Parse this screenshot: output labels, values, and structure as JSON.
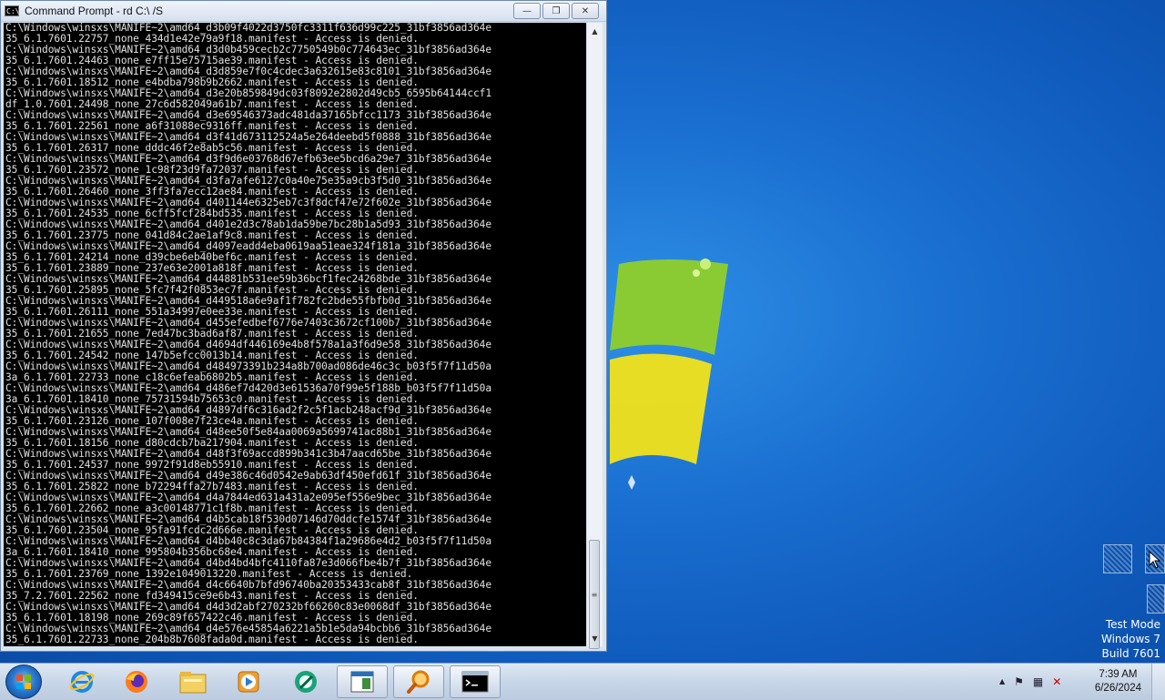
{
  "window": {
    "title": "Command Prompt - rd  C:\\ /S",
    "icon_label": "C:\\",
    "minimize_glyph": "—",
    "maximize_glyph": "❐",
    "close_glyph": "✕"
  },
  "console": {
    "lines": [
      "C:\\Windows\\winsxs\\MANIFE~2\\amd64_d3b09f4022d3750fc3311f636d99c225_31bf3856ad364e",
      "35_6.1.7601.22757_none_434d1e42e79a9f18.manifest - Access is denied.",
      "C:\\Windows\\winsxs\\MANIFE~2\\amd64_d3d0b459cecb2c7750549b0c774643ec_31bf3856ad364e",
      "35_6.1.7601.24463_none_e7ff15e75715ae39.manifest - Access is denied.",
      "C:\\Windows\\winsxs\\MANIFE~2\\amd64_d3d859e7f0c4cdec3a632615e83c8101_31bf3856ad364e",
      "35_6.1.7601.18512_none_e4bdba798b9b2662.manifest - Access is denied.",
      "C:\\Windows\\winsxs\\MANIFE~2\\amd64_d3e20b859849dc03f8092e2802d49cb5_6595b64144ccf1",
      "df_1.0.7601.24498_none_27c6d582049a61b7.manifest - Access is denied.",
      "C:\\Windows\\winsxs\\MANIFE~2\\amd64_d3e69546373adc481da37165bfcc1173_31bf3856ad364e",
      "35_6.1.7601.22561_none_a6f31088ec9316ff.manifest - Access is denied.",
      "C:\\Windows\\winsxs\\MANIFE~2\\amd64_d3f41d673112524a5e264deebd5f0888_31bf3856ad364e",
      "35_6.1.7601.26317_none_dddc46f2e8ab5c56.manifest - Access is denied.",
      "C:\\Windows\\winsxs\\MANIFE~2\\amd64_d3f9d6e03768d67efb63ee5bcd6a29e7_31bf3856ad364e",
      "35_6.1.7601.23572_none_1c98f23d9fa72037.manifest - Access is denied.",
      "C:\\Windows\\winsxs\\MANIFE~2\\amd64_d3fa7afe6127c0a40e75e35a9cb3f5d0_31bf3856ad364e",
      "35_6.1.7601.26460_none_3ff3fa7ecc12ae84.manifest - Access is denied.",
      "C:\\Windows\\winsxs\\MANIFE~2\\amd64_d401144e6325eb7c3f8dcf47e72f602e_31bf3856ad364e",
      "35_6.1.7601.24535_none_6cff5fcf284bd535.manifest - Access is denied.",
      "C:\\Windows\\winsxs\\MANIFE~2\\amd64_d401e2d3c78ab1da59be7bc28b1a5d93_31bf3856ad364e",
      "35_6.1.7601.23775_none_041d84c2ae1af9c8.manifest - Access is denied.",
      "C:\\Windows\\winsxs\\MANIFE~2\\amd64_d4097eadd4eba0619aa51eae324f181a_31bf3856ad364e",
      "35_6.1.7601.24214_none_d39cbe6eb40bef6c.manifest - Access is denied.",
      "35_6.1.7601.23889_none_237e63e2001a818f.manifest - Access is denied.",
      "C:\\Windows\\winsxs\\MANIFE~2\\amd64_d44881b531ee59b36bcf1fec24268bde_31bf3856ad364e",
      "35_6.1.7601.25895_none_5fc7f42f0853ec7f.manifest - Access is denied.",
      "C:\\Windows\\winsxs\\MANIFE~2\\amd64_d449518a6e9af1f782fc2bde55fbfb0d_31bf3856ad364e",
      "35_6.1.7601.26111_none_551a34997e0ee33e.manifest - Access is denied.",
      "C:\\Windows\\winsxs\\MANIFE~2\\amd64_d455efedbef6776e7403c3672cf100b7_31bf3856ad364e",
      "35_6.1.7601.21655_none_7ed47bc3bad6af87.manifest - Access is denied.",
      "C:\\Windows\\winsxs\\MANIFE~2\\amd64_d4694df446169e4b8f578a1a3f6d9e58_31bf3856ad364e",
      "35_6.1.7601.24542_none_147b5efcc0013b14.manifest - Access is denied.",
      "C:\\Windows\\winsxs\\MANIFE~2\\amd64_d484973391b234a8b700ad086de46c3c_b03f5f7f11d50a",
      "3a_6.1.7601.22733_none_c18c6efeab6802b5.manifest - Access is denied.",
      "C:\\Windows\\winsxs\\MANIFE~2\\amd64_d486ef7d420d3e61536a70f99e5f188b_b03f5f7f11d50a",
      "3a_6.1.7601.18410_none_75731594b75653c0.manifest - Access is denied.",
      "C:\\Windows\\winsxs\\MANIFE~2\\amd64_d4897df6c316ad2f2c5f1acb248acf9d_31bf3856ad364e",
      "35_6.1.7601.23126_none_107f008e7f23ce4a.manifest - Access is denied.",
      "C:\\Windows\\winsxs\\MANIFE~2\\amd64_d48ee50f5e84aa0069a5699741ac88b1_31bf3856ad364e",
      "35_6.1.7601.18156_none_d80cdcb7ba217904.manifest - Access is denied.",
      "C:\\Windows\\winsxs\\MANIFE~2\\amd64_d48f3f69accd899b341c3b47aacd65be_31bf3856ad364e",
      "35_6.1.7601.24537_none_9972f91d8eb55910.manifest - Access is denied.",
      "C:\\Windows\\winsxs\\MANIFE~2\\amd64_d49e386c46d0542e9ab63df450efd61f_31bf3856ad364e",
      "35_6.1.7601.25822_none_b72294ffa27b7483.manifest - Access is denied.",
      "C:\\Windows\\winsxs\\MANIFE~2\\amd64_d4a7844ed631a431a2e095ef556e9bec_31bf3856ad364e",
      "35_6.1.7601.22662_none_a3c00148771c1f8b.manifest - Access is denied.",
      "C:\\Windows\\winsxs\\MANIFE~2\\amd64_d4b5cab18f530d07146d70ddcfe1574f_31bf3856ad364e",
      "35_6.1.7601.23504_none_95fa91fcdc2d666e.manifest - Access is denied.",
      "C:\\Windows\\winsxs\\MANIFE~2\\amd64_d4bb40c8c3da67b84384f1a29686e4d2_b03f5f7f11d50a",
      "3a_6.1.7601.18410_none_995804b356bc68e4.manifest - Access is denied.",
      "C:\\Windows\\winsxs\\MANIFE~2\\amd64_d4bd4bd4bfc4110fa87e3d066fbe4b7f_31bf3856ad364e",
      "35_6.1.7601.23769_none_1392e1049013220.manifest - Access is denied.",
      "C:\\Windows\\winsxs\\MANIFE~2\\amd64_d4c6640b7bfd96740ba20353433cab8f_31bf3856ad364e",
      "35_7.2.7601.22562_none_fd349415ce9e6b43.manifest - Access is denied.",
      "C:\\Windows\\winsxs\\MANIFE~2\\amd64_d4d3d2abf270232bf66260c83e0068df_31bf3856ad364e",
      "35_6.1.7601.18198_none_269c89f657422c46.manifest - Access is denied.",
      "C:\\Windows\\winsxs\\MANIFE~2\\amd64_d4e576e45854a6221a5b1e5da94bcbb6_31bf3856ad364e",
      "35_6.1.7601.22733_none_204b8b7608fada0d.manifest - Access is denied."
    ]
  },
  "watermark": {
    "line1": "Test Mode",
    "line2": "Windows 7",
    "line3": "Build 7601"
  },
  "clock": {
    "time": "7:39 AM",
    "date": "6/26/2024"
  },
  "taskbar": {
    "items": [
      "start-orb",
      "internet-explorer-icon",
      "firefox-icon",
      "file-explorer-icon",
      "media-player-icon",
      "green-app-icon",
      "notes-app-icon",
      "search-magnifier-icon",
      "command-prompt-icon"
    ]
  },
  "tray": {
    "overflow_glyph": "▲",
    "flag_glyph": "⚑",
    "network_glyph": "▦",
    "volume_glyph": "✕"
  },
  "colors": {
    "console_bg": "#000000",
    "console_fg": "#e0e0e0",
    "desktop_blue": "#1a6fd0",
    "logo_green": "#8fcf2a",
    "logo_yellow": "#f2e11a"
  }
}
